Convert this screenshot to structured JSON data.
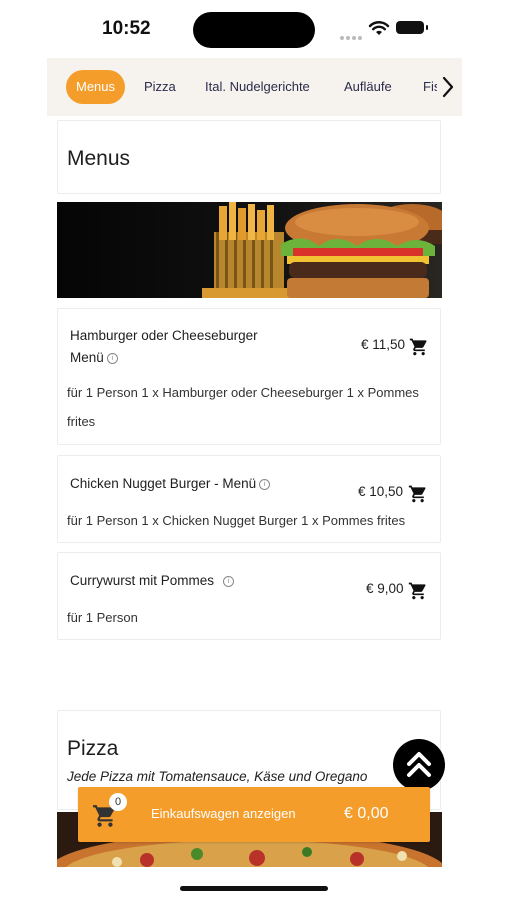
{
  "status": {
    "time": "10:52"
  },
  "categories": [
    "Menus",
    "Pizza",
    "Ital. Nudelgerichte",
    "Aufläufe",
    "Fis"
  ],
  "menus_section": {
    "title": "Menus",
    "items": [
      {
        "name_line1": "Hamburger oder Cheeseburger",
        "name_line2": "Menü",
        "price": "€ 11,50",
        "desc_line1": "für 1 Person 1 x Hamburger oder Cheeseburger 1 x Pommes",
        "desc_line2": "frites"
      },
      {
        "name": "Chicken Nugget Burger - Menü",
        "price": "€ 10,50",
        "desc": "für 1 Person 1 x Chicken Nugget Burger 1 x Pommes frites"
      },
      {
        "name": "Currywurst mit Pommes",
        "price": "€ 9,00",
        "desc": "für 1 Person"
      }
    ]
  },
  "pizza_section": {
    "title": "Pizza",
    "subtitle": "Jede Pizza mit Tomatensauce, Käse und Oregano"
  },
  "cart": {
    "count": "0",
    "label": "Einkaufswagen anzeigen",
    "total": "€ 0,00"
  },
  "colors": {
    "accent": "#f59d2a",
    "tab_bg": "#f6f3ef"
  }
}
